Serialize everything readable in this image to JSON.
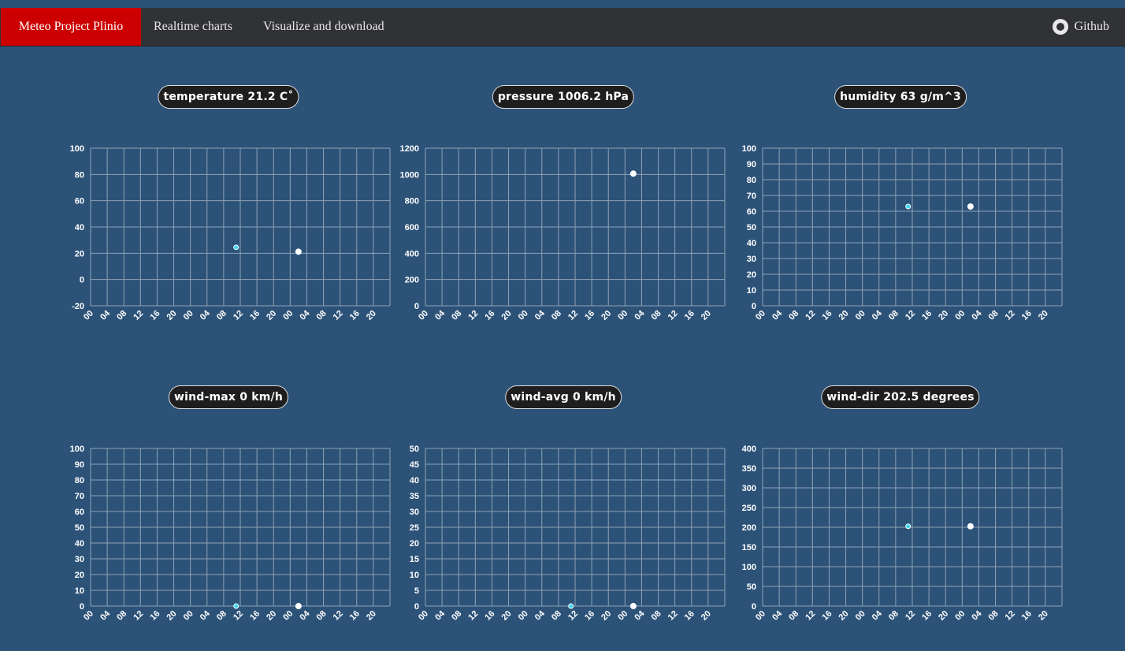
{
  "navbar": {
    "brand": "Meteo Project Plinio",
    "links": [
      "Realtime charts",
      "Visualize and download"
    ],
    "github": "Github",
    "github_icon": "github-icon",
    "brand_color": "#cc0000"
  },
  "x_ticks": [
    "00",
    "04",
    "08",
    "12",
    "16",
    "20",
    "00",
    "04",
    "08",
    "12",
    "16",
    "20",
    "00",
    "04",
    "08",
    "12",
    "16",
    "20"
  ],
  "charts": [
    {
      "title": "temperature 21.2 C˚",
      "yticks": [
        "100",
        "80",
        "60",
        "40",
        "20",
        "0",
        "-20"
      ]
    },
    {
      "title": "pressure 1006.2 hPa",
      "yticks": [
        "1200",
        "1000",
        "800",
        "600",
        "400",
        "200",
        "0"
      ]
    },
    {
      "title": "humidity 63 g/m^3",
      "yticks": [
        "100",
        "90",
        "80",
        "70",
        "60",
        "50",
        "40",
        "30",
        "20",
        "10",
        "0"
      ]
    },
    {
      "title": "wind-max 0 km/h",
      "yticks": [
        "100",
        "90",
        "80",
        "70",
        "60",
        "50",
        "40",
        "30",
        "20",
        "10",
        "0"
      ]
    },
    {
      "title": "wind-avg 0 km/h",
      "yticks": [
        "50",
        "45",
        "40",
        "35",
        "30",
        "25",
        "20",
        "15",
        "10",
        "5",
        "0"
      ]
    },
    {
      "title": "wind-dir 202.5 degrees",
      "yticks": [
        "400",
        "350",
        "300",
        "250",
        "200",
        "150",
        "100",
        "50",
        "0"
      ]
    }
  ],
  "chart_data": [
    {
      "type": "scatter",
      "title": "temperature 21.2 C˚",
      "ylim": [
        -20,
        100
      ],
      "x_range_hours": [
        0,
        72
      ],
      "grid": true,
      "series": [
        {
          "color": "#3ad8f0",
          "points": [
            {
              "x": 35,
              "y": 24.5
            }
          ]
        },
        {
          "color": "#ffffff",
          "points": [
            {
              "x": 50,
              "y": 21.2
            }
          ]
        }
      ]
    },
    {
      "type": "scatter",
      "title": "pressure 1006.2 hPa",
      "ylim": [
        0,
        1200
      ],
      "x_range_hours": [
        0,
        72
      ],
      "grid": true,
      "series": [
        {
          "color": "#ffffff",
          "points": [
            {
              "x": 50,
              "y": 1006.2
            }
          ]
        }
      ]
    },
    {
      "type": "scatter",
      "title": "humidity 63 g/m^3",
      "ylim": [
        0,
        100
      ],
      "x_range_hours": [
        0,
        72
      ],
      "grid": true,
      "series": [
        {
          "color": "#3ad8f0",
          "points": [
            {
              "x": 35,
              "y": 63
            }
          ]
        },
        {
          "color": "#ffffff",
          "points": [
            {
              "x": 50,
              "y": 63
            }
          ]
        }
      ]
    },
    {
      "type": "scatter",
      "title": "wind-max 0 km/h",
      "ylim": [
        0,
        100
      ],
      "x_range_hours": [
        0,
        72
      ],
      "grid": true,
      "series": [
        {
          "color": "#3ad8f0",
          "points": [
            {
              "x": 35,
              "y": 0
            }
          ]
        },
        {
          "color": "#ffffff",
          "points": [
            {
              "x": 50,
              "y": 0
            }
          ]
        }
      ]
    },
    {
      "type": "scatter",
      "title": "wind-avg 0 km/h",
      "ylim": [
        0,
        50
      ],
      "x_range_hours": [
        0,
        72
      ],
      "grid": true,
      "series": [
        {
          "color": "#3ad8f0",
          "points": [
            {
              "x": 35,
              "y": 0
            }
          ]
        },
        {
          "color": "#ffffff",
          "points": [
            {
              "x": 50,
              "y": 0
            }
          ]
        }
      ]
    },
    {
      "type": "scatter",
      "title": "wind-dir 202.5 degrees",
      "ylim": [
        0,
        400
      ],
      "x_range_hours": [
        0,
        72
      ],
      "grid": true,
      "series": [
        {
          "color": "#3ad8f0",
          "points": [
            {
              "x": 35,
              "y": 202.5
            }
          ]
        },
        {
          "color": "#ffffff",
          "points": [
            {
              "x": 50,
              "y": 202.5
            }
          ]
        }
      ]
    }
  ]
}
